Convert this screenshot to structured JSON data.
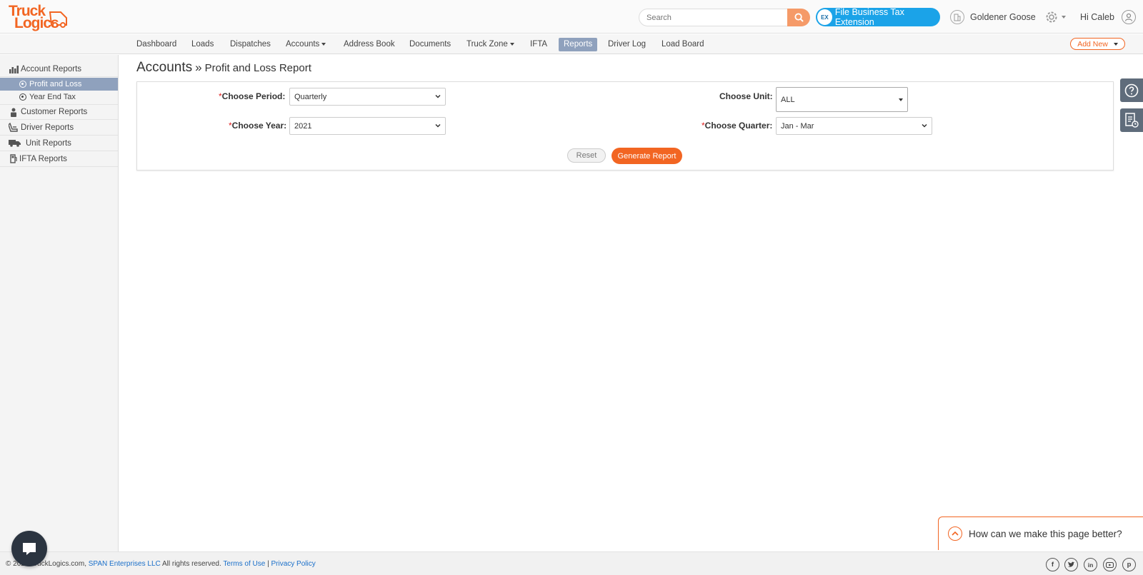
{
  "brand": {
    "line1": "Truck",
    "line2": "Logics",
    "color": "#f26522"
  },
  "header": {
    "search_placeholder": "Search",
    "tax_badge": "EX",
    "tax_button": "File Business Tax Extension",
    "company": "Goldener Goose",
    "greeting": "Hi Caleb"
  },
  "nav": {
    "items": [
      "Dashboard",
      "Loads",
      "Dispatches",
      "Accounts",
      "Address Book",
      "Documents",
      "Truck Zone",
      "IFTA",
      "Reports",
      "Driver Log",
      "Load Board"
    ],
    "active": "Reports",
    "add_new": "Add New"
  },
  "sidebar": {
    "groups": [
      {
        "label": "Account Reports",
        "icon": "bar-chart-icon"
      },
      {
        "label": "Customer Reports",
        "icon": "person-icon"
      },
      {
        "label": "Driver Reports",
        "icon": "driver-seat-icon"
      },
      {
        "label": "Unit Reports",
        "icon": "truck-icon"
      },
      {
        "label": "IFTA Reports",
        "icon": "fuel-pump-icon"
      }
    ],
    "subitems": [
      {
        "label": "Profit and Loss",
        "active": true
      },
      {
        "label": "Year End Tax",
        "active": false
      }
    ]
  },
  "page": {
    "crumb_main": "Accounts",
    "crumb_sep": "»",
    "crumb_sub": "Profit and Loss Report"
  },
  "form": {
    "period_label": "Choose Period:",
    "period_value": "Quarterly",
    "year_label": "Choose Year:",
    "year_value": "2021",
    "unit_label": "Choose Unit:",
    "unit_value": "ALL",
    "quarter_label": "Choose Quarter:",
    "quarter_value": "Jan - Mar",
    "required_mark": "*",
    "reset": "Reset",
    "generate": "Generate Report"
  },
  "feedback": {
    "text": "How can we make this page better?"
  },
  "footer": {
    "prefix": "© 2021 TruckLogics.com,",
    "company_link": "SPAN Enterprises LLC",
    "rights": "All rights reserved.",
    "terms": "Terms of Use",
    "divider": "|",
    "privacy": "Privacy Policy",
    "social": [
      "facebook-icon",
      "twitter-icon",
      "linkedin-icon",
      "youtube-icon",
      "pinterest-icon"
    ]
  },
  "colors": {
    "accent": "#f26522",
    "nav_active": "#8fa1bd",
    "tax_button": "#1ba3e8",
    "link": "#1a6fc9"
  }
}
